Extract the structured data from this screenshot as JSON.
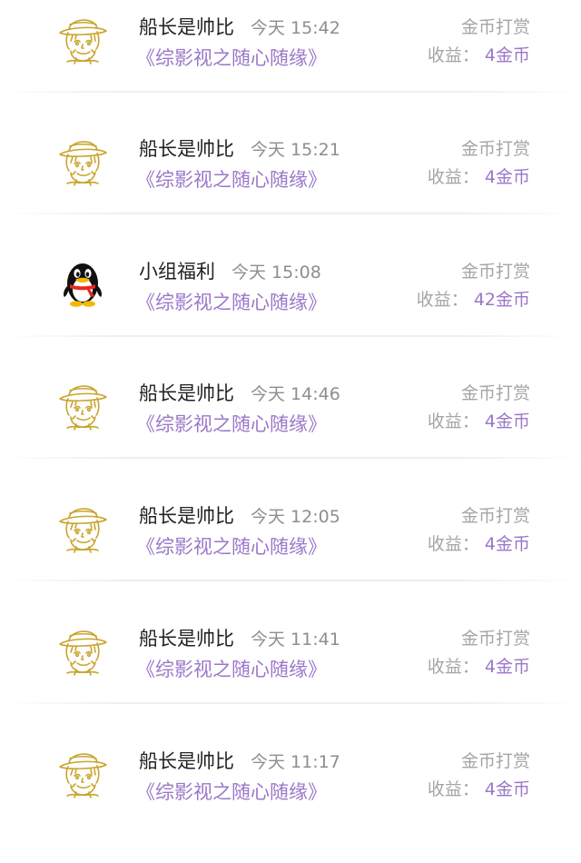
{
  "entries": [
    {
      "avatar": "straw-hat-sketch-avatar",
      "name": "船长是帅比",
      "time": "今天 15:42",
      "book": "《综影视之随心随缘》",
      "type": "金币打赏",
      "earn_label": "收益：",
      "earn_value": "4金币"
    },
    {
      "avatar": "straw-hat-sketch-avatar",
      "name": "船长是帅比",
      "time": "今天 15:21",
      "book": "《综影视之随心随缘》",
      "type": "金币打赏",
      "earn_label": "收益：",
      "earn_value": "4金币"
    },
    {
      "avatar": "qq-penguin-avatar",
      "name": "小组福利",
      "time": "今天 15:08",
      "book": "《综影视之随心随缘》",
      "type": "金币打赏",
      "earn_label": "收益：",
      "earn_value": "42金币"
    },
    {
      "avatar": "straw-hat-sketch-avatar",
      "name": "船长是帅比",
      "time": "今天 14:46",
      "book": "《综影视之随心随缘》",
      "type": "金币打赏",
      "earn_label": "收益：",
      "earn_value": "4金币"
    },
    {
      "avatar": "straw-hat-sketch-avatar",
      "name": "船长是帅比",
      "time": "今天 12:05",
      "book": "《综影视之随心随缘》",
      "type": "金币打赏",
      "earn_label": "收益：",
      "earn_value": "4金币"
    },
    {
      "avatar": "straw-hat-sketch-avatar",
      "name": "船长是帅比",
      "time": "今天 11:41",
      "book": "《综影视之随心随缘》",
      "type": "金币打赏",
      "earn_label": "收益：",
      "earn_value": "4金币"
    },
    {
      "avatar": "straw-hat-sketch-avatar",
      "name": "船长是帅比",
      "time": "今天 11:17",
      "book": "《综影视之随心随缘》",
      "type": "金币打赏",
      "earn_label": "收益：",
      "earn_value": "4金币"
    }
  ],
  "colors": {
    "name_text": "#222222",
    "time_text": "#8e8e8e",
    "book_text": "#9b77c9",
    "secondary_text": "#a5a5a5",
    "earn_value_text": "#9b77c9",
    "sketch_gold": "#c9a42c"
  }
}
